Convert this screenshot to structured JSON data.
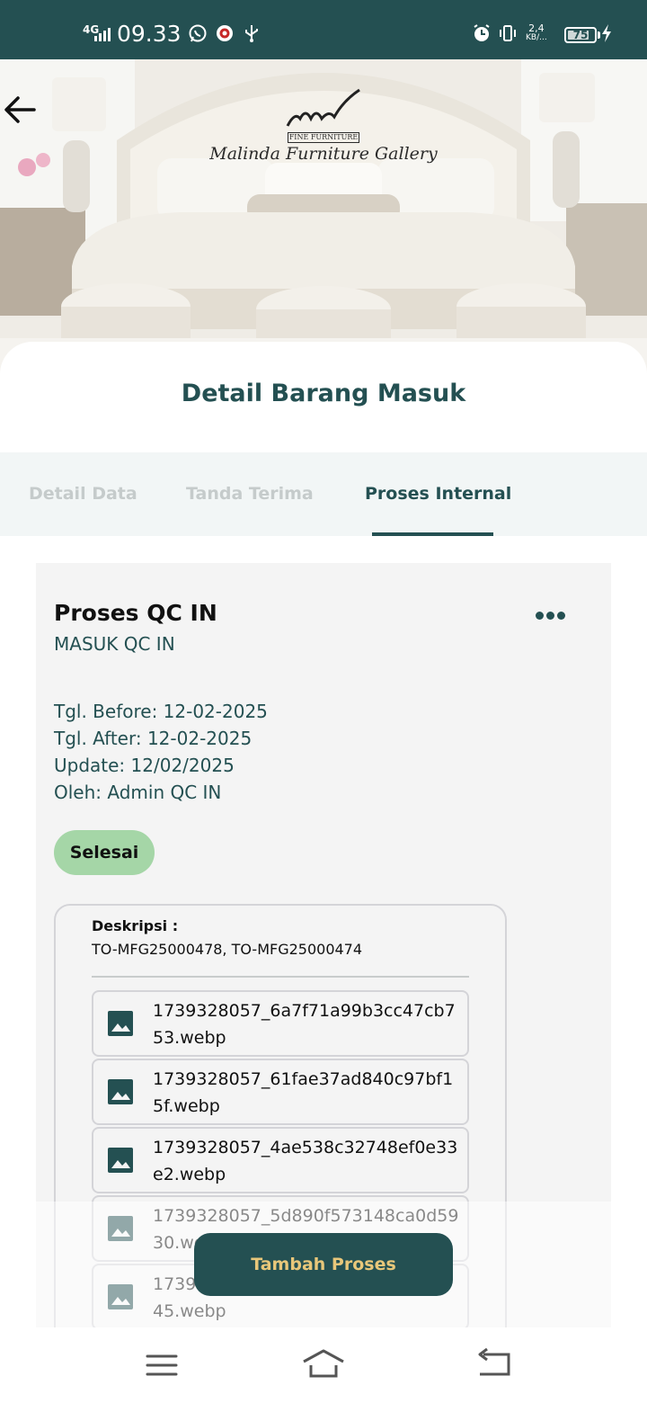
{
  "status_bar": {
    "network": "4G",
    "time": "09.33",
    "speed_value": "2,4",
    "speed_unit": "KB/...",
    "battery": "75",
    "icons": [
      "signal-icon",
      "whatsapp-icon",
      "app-notification-icon",
      "usb-icon",
      "alarm-icon",
      "vibrate-icon",
      "battery-icon",
      "charging-icon"
    ]
  },
  "header": {
    "back_icon": "arrow-left-icon",
    "logo_tag": "FINE FURNITURE",
    "logo_brand": "Malinda Furniture Gallery"
  },
  "page": {
    "title": "Detail Barang Masuk"
  },
  "tabs": [
    {
      "label": "Detail Data",
      "active": false
    },
    {
      "label": "Tanda Terima",
      "active": false
    },
    {
      "label": "Proses Internal",
      "active": true
    }
  ],
  "process_card": {
    "title": "Proses QC IN",
    "subtitle": "MASUK QC IN",
    "more_icon": "more-horizontal-icon",
    "info": [
      "Tgl. Before: 12-02-2025",
      "Tgl. After: 12-02-2025",
      "Update: 12/02/2025",
      "Oleh: Admin QC IN"
    ],
    "status": "Selesai",
    "description_label": "Deskripsi :",
    "description_value": "TO-MFG25000478, TO-MFG25000474",
    "files": [
      "1739328057_6a7f71a99b3cc47cb753.webp",
      "1739328057_61fae37ad840c97bf15f.webp",
      "1739328057_4ae538c32748ef0e33e2.webp",
      "1739328057_5d890f573148ca0d5930.webp",
      "45.webp"
    ],
    "partial_file_prefix": "17393",
    "partial_file_tail": "5"
  },
  "fab": {
    "label": "Tambah Proses"
  },
  "colors": {
    "primary": "#245052",
    "accent_text": "#e8c77a",
    "status_success_bg": "#a5d6a7",
    "card_bg": "#f4f4f4",
    "tab_bg": "#f2f6f6"
  },
  "nav_bar": {
    "icons": [
      "menu-icon",
      "home-icon",
      "back-icon"
    ]
  }
}
